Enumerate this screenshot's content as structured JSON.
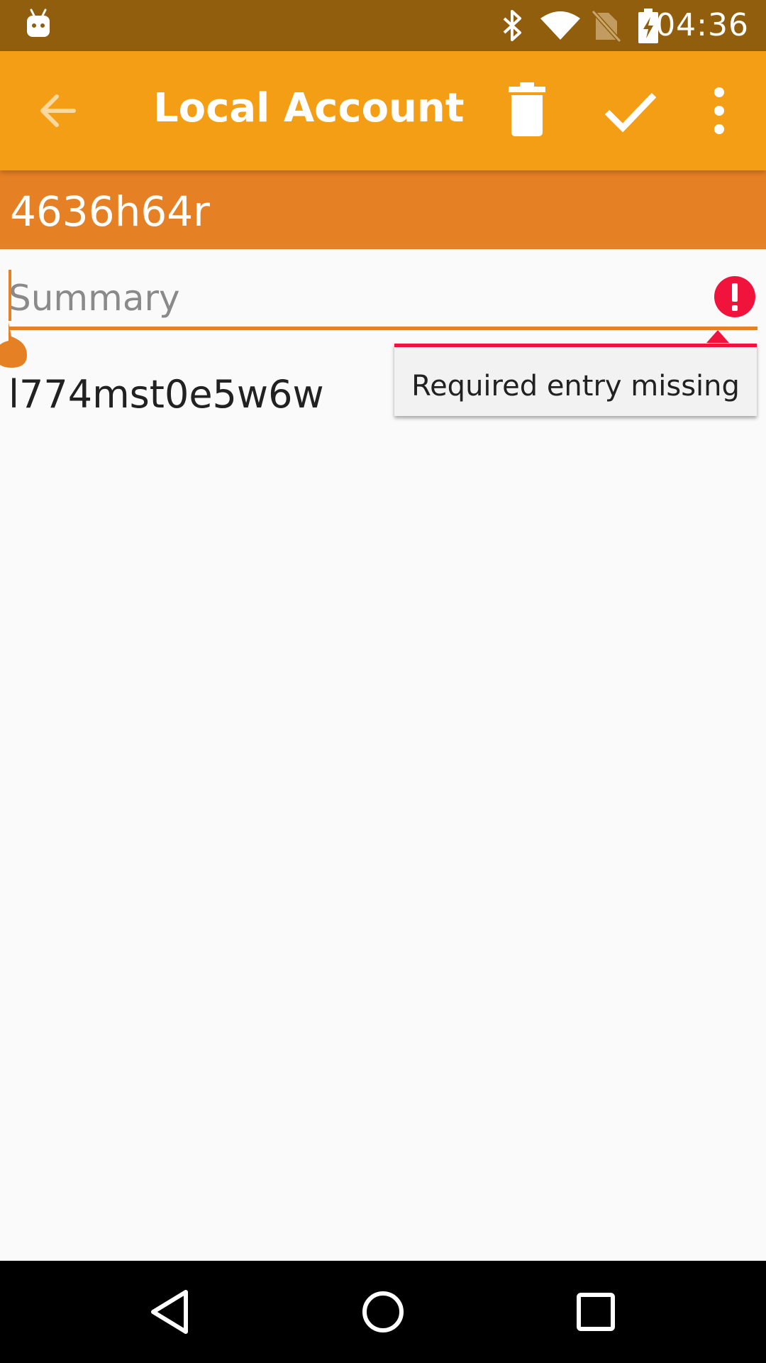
{
  "status_bar": {
    "time": "04:36",
    "icons": [
      "android-notification-icon",
      "bluetooth-icon",
      "wifi-icon",
      "no-sim-icon",
      "battery-charging-icon"
    ]
  },
  "app_bar": {
    "title": "Local Account",
    "actions": [
      "back-arrow-icon",
      "delete-icon",
      "save-check-icon",
      "overflow-menu-icon"
    ]
  },
  "header": {
    "name": "4636h64r"
  },
  "summary_field": {
    "placeholder": "Summary",
    "value": ""
  },
  "value_text": "l774mst0e5w6w",
  "error_popup": {
    "message": "Required entry missing"
  },
  "colors": {
    "status_bar": "#915e0e",
    "app_bar": "#f39e15",
    "header": "#e58024",
    "accent": "#e58024",
    "error": "#f0143c"
  },
  "nav_bar": {
    "buttons": [
      "back-triangle-icon",
      "home-circle-icon",
      "recents-square-icon"
    ]
  }
}
